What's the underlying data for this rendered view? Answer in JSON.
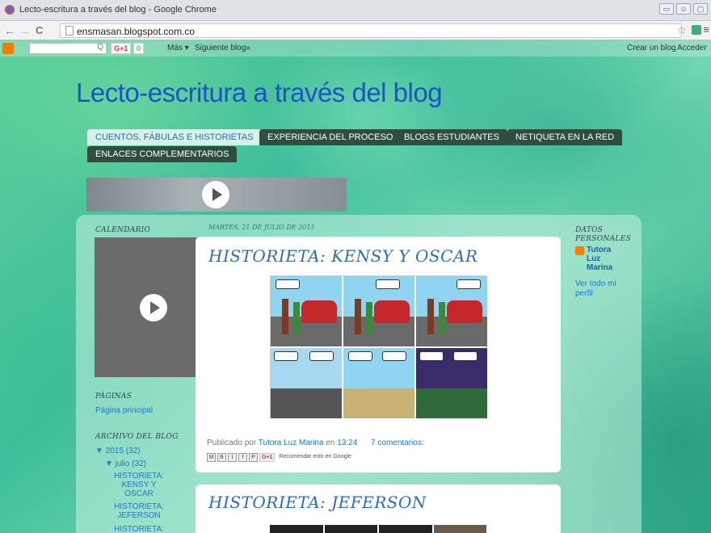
{
  "window": {
    "title": "Lecto-escritura a través del blog - Google Chrome"
  },
  "browser": {
    "url": "ensmasan.blogspot.com.co",
    "back": "←",
    "forward": "→",
    "reload": "C",
    "star": "☆",
    "menu": "≡"
  },
  "blogger_bar": {
    "search_icon": "Q",
    "gplus": "G+1",
    "gplus_count": "0",
    "more": "Más ▾",
    "next_blog": "Siguiente blog»",
    "create_blog": "Crear un blog",
    "sign_in": "Acceder"
  },
  "blog": {
    "title": "Lecto-escritura a través del blog"
  },
  "tabs": [
    {
      "label": "CUENTOS, FÁBULAS E HISTORIETAS",
      "active": true
    },
    {
      "label": "EXPERIENCIA DEL PROCESO",
      "active": false
    },
    {
      "label": "BLOGS ESTUDIANTES",
      "active": false
    },
    {
      "label": "NETIQUETA EN LA RED",
      "active": false
    },
    {
      "label": "ENLACES COMPLEMENTARIOS",
      "active": false
    }
  ],
  "sidebar_left": {
    "calendar_heading": "CALENDARIO",
    "pages_heading": "PÁGINAS",
    "pages_link": "Página principal",
    "archive_heading": "ARCHIVO DEL BLOG",
    "year": "▼ 2015 (32)",
    "month": "▼ julio (32)",
    "posts": [
      "HISTORIETA: KENSY Y OSCAR",
      "HISTORIETA: JEFERSON",
      "HISTORIETA:"
    ]
  },
  "sidebar_right": {
    "heading": "DATOS PERSONALES",
    "profile_name": "Tutora Luz Marina",
    "view_profile": "Ver todo mi perfil"
  },
  "post1": {
    "date": "MARTES, 21 DE JULIO DE 2015",
    "title": "HISTORIETA: KENSY Y OSCAR",
    "published_by": "Publicado por",
    "author": "Tutora Luz Marina",
    "at": "en",
    "time": "13:24",
    "comments": "7 comentarios:",
    "recommend": "Recomendar esto en Google",
    "gplus": "G+1"
  },
  "post2": {
    "title": "HISTORIETA: JEFERSON"
  },
  "colors": {
    "title": "#1b55c5",
    "tab": "#2f4e3f",
    "link": "#1a7ad0"
  }
}
